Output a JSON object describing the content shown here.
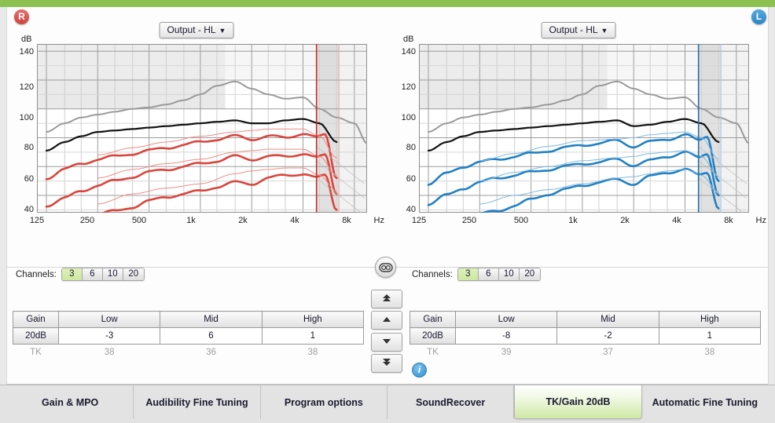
{
  "colors": {
    "accent_green": "#8cc152",
    "right_ear": "#d9534f",
    "left_ear": "#2f93d0",
    "right_curve": "#d9453c",
    "left_curve": "#2180c4",
    "mpo_curve": "#9a9a9a",
    "target_curve": "#111111",
    "selected_tab": "#cfe8a4"
  },
  "ear_badges": {
    "right": "R",
    "left": "L"
  },
  "panels": [
    {
      "side": "right",
      "dropdown_label": "Output - HL",
      "dropdown_caret": "▼",
      "channels_label": "Channels:",
      "channel_options": [
        "3",
        "6",
        "10",
        "20"
      ],
      "channel_selected": "3"
    },
    {
      "side": "left",
      "dropdown_label": "Output - HL",
      "dropdown_caret": "▼",
      "channels_label": "Channels:",
      "channel_options": [
        "3",
        "6",
        "10",
        "20"
      ],
      "channel_selected": "3"
    }
  ],
  "chart_data": [
    {
      "type": "line",
      "title": "Output - HL (Right ear)",
      "xlabel": "Hz",
      "ylabel": "dB",
      "x_tick_labels": [
        "125",
        "250",
        "500",
        "1k",
        "2k",
        "4k",
        "8k"
      ],
      "x_tick_hz": [
        125,
        250,
        500,
        1000,
        2000,
        4000,
        8000
      ],
      "y_tick_labels": [
        "140",
        "120",
        "100",
        "80",
        "60",
        "40"
      ],
      "ylim": [
        28,
        145
      ],
      "xlim_hz": [
        110,
        9500
      ],
      "grid": true,
      "legend": "none",
      "soundrecover_cutoff_hz": 4800,
      "series": [
        {
          "name": "MPO",
          "color": "#9a9a9a",
          "width": 2,
          "x": [
            125,
            160,
            200,
            250,
            315,
            400,
            500,
            630,
            800,
            1000,
            1250,
            1600,
            2000,
            2500,
            3150,
            4000,
            5000,
            6300,
            8000,
            9500
          ],
          "values": [
            84,
            90,
            94,
            96,
            98,
            100,
            101,
            103,
            106,
            110,
            116,
            119,
            114,
            110,
            107,
            108,
            100,
            94,
            90,
            76
          ]
        },
        {
          "name": "Target / 80 dB input",
          "color": "#111111",
          "width": 2.2,
          "x": [
            125,
            160,
            200,
            250,
            315,
            400,
            500,
            630,
            800,
            1000,
            1250,
            1600,
            2000,
            2500,
            3150,
            4000,
            5000,
            6300
          ],
          "values": [
            71,
            77,
            81,
            84,
            85,
            86,
            87,
            88,
            89,
            90,
            91,
            92,
            90,
            90,
            92,
            93,
            90,
            77
          ]
        },
        {
          "name": "Output 75 dB input",
          "color": "#d9453c",
          "width": 2.6,
          "x": [
            125,
            160,
            200,
            250,
            315,
            400,
            500,
            630,
            800,
            1000,
            1250,
            1600,
            2000,
            2500,
            3150,
            4000,
            4800,
            5400,
            6300
          ],
          "values": [
            52,
            58,
            62,
            65,
            67,
            69,
            71,
            73,
            75,
            77,
            79,
            81,
            79,
            81,
            80,
            83,
            80,
            82,
            52
          ]
        },
        {
          "name": "Output 55 dB input",
          "color": "#d9453c",
          "width": 2.6,
          "x": [
            125,
            160,
            200,
            250,
            315,
            400,
            500,
            630,
            800,
            1000,
            1250,
            1600,
            2000,
            2500,
            3150,
            4000,
            4800,
            5400,
            6300
          ],
          "values": [
            33,
            38,
            43,
            47,
            50,
            53,
            56,
            58,
            60,
            62,
            64,
            67,
            65,
            67,
            67,
            69,
            66,
            68,
            41
          ]
        },
        {
          "name": "Output 40 dB input",
          "color": "#d9453c",
          "width": 2.6,
          "x": [
            250,
            315,
            400,
            500,
            630,
            800,
            1000,
            1250,
            1600,
            2000,
            2500,
            3150,
            4000,
            4800,
            5400,
            6300
          ],
          "values": [
            27,
            29,
            32,
            36,
            39,
            41,
            43,
            46,
            49,
            48,
            52,
            54,
            55,
            52,
            54,
            30
          ]
        },
        {
          "name": "Unaided 75 dB reference",
          "color": "#ef8c86",
          "width": 1,
          "x": [
            250,
            400,
            630,
            1000,
            1600,
            2000,
            2500,
            3150,
            4000,
            5000,
            6300
          ],
          "values": [
            68,
            73,
            77,
            81,
            84,
            85,
            86,
            86,
            86,
            81,
            66
          ]
        },
        {
          "name": "Unaided 55 dB reference",
          "color": "#ef8c86",
          "width": 1,
          "x": [
            250,
            400,
            630,
            1000,
            1600,
            2000,
            2500,
            3150,
            4000,
            5000,
            6300
          ],
          "values": [
            52,
            58,
            62,
            65,
            70,
            71,
            72,
            72,
            72,
            67,
            54
          ]
        },
        {
          "name": "Unaided 40 dB reference",
          "color": "#ef8c86",
          "width": 1,
          "x": [
            250,
            400,
            630,
            1000,
            1600,
            2000,
            2500,
            3150,
            4000,
            5000,
            6300
          ],
          "values": [
            34,
            41,
            45,
            48,
            55,
            57,
            58,
            59,
            59,
            54,
            43
          ]
        }
      ]
    },
    {
      "type": "line",
      "title": "Output - HL (Left ear)",
      "xlabel": "Hz",
      "ylabel": "dB",
      "x_tick_labels": [
        "125",
        "250",
        "500",
        "1k",
        "2k",
        "4k",
        "8k"
      ],
      "x_tick_hz": [
        125,
        250,
        500,
        1000,
        2000,
        4000,
        8000
      ],
      "y_tick_labels": [
        "140",
        "120",
        "100",
        "80",
        "60",
        "40"
      ],
      "ylim": [
        28,
        145
      ],
      "xlim_hz": [
        110,
        9500
      ],
      "grid": true,
      "legend": "none",
      "soundrecover_cutoff_hz": 4800,
      "series": [
        {
          "name": "MPO",
          "color": "#9a9a9a",
          "width": 2,
          "x": [
            125,
            160,
            200,
            250,
            315,
            400,
            500,
            630,
            800,
            1000,
            1250,
            1600,
            2000,
            2500,
            3150,
            4000,
            5000,
            6300,
            8000,
            9500
          ],
          "values": [
            84,
            90,
            94,
            96,
            98,
            100,
            101,
            103,
            106,
            110,
            116,
            119,
            114,
            110,
            107,
            108,
            100,
            94,
            90,
            76
          ]
        },
        {
          "name": "Target / 80 dB input",
          "color": "#111111",
          "width": 2.2,
          "x": [
            125,
            160,
            200,
            250,
            315,
            400,
            500,
            630,
            800,
            1000,
            1250,
            1600,
            2000,
            2500,
            3150,
            4000,
            5000,
            6300
          ],
          "values": [
            71,
            77,
            81,
            84,
            85,
            86,
            87,
            88,
            89,
            90,
            91,
            92,
            88,
            89,
            91,
            93,
            90,
            77
          ]
        },
        {
          "name": "Output 75 dB input",
          "color": "#2180c4",
          "width": 2.6,
          "x": [
            125,
            160,
            200,
            250,
            315,
            400,
            500,
            630,
            800,
            1000,
            1250,
            1600,
            2000,
            2500,
            3150,
            4000,
            4800,
            5400,
            6300
          ],
          "values": [
            48,
            55,
            60,
            63,
            65,
            67,
            69,
            71,
            73,
            75,
            76,
            78,
            74,
            77,
            79,
            82,
            78,
            81,
            50
          ]
        },
        {
          "name": "Output 55 dB input",
          "color": "#2180c4",
          "width": 2.6,
          "x": [
            125,
            160,
            200,
            250,
            315,
            400,
            500,
            630,
            800,
            1000,
            1250,
            1600,
            2000,
            2500,
            3150,
            4000,
            4800,
            5400,
            6300
          ],
          "values": [
            34,
            40,
            45,
            49,
            52,
            54,
            56,
            58,
            60,
            62,
            63,
            65,
            61,
            64,
            67,
            70,
            66,
            69,
            40
          ]
        },
        {
          "name": "Output 40 dB input",
          "color": "#2180c4",
          "width": 2.6,
          "x": [
            250,
            315,
            400,
            500,
            630,
            800,
            1000,
            1250,
            1600,
            2000,
            2500,
            3150,
            4000,
            4800,
            5400,
            6300
          ],
          "values": [
            27,
            29,
            33,
            37,
            41,
            44,
            47,
            49,
            51,
            48,
            53,
            56,
            58,
            54,
            56,
            31
          ]
        },
        {
          "name": "Unaided 75 dB reference",
          "color": "#7db9e2",
          "width": 1,
          "x": [
            250,
            400,
            630,
            1000,
            1600,
            2000,
            2500,
            3150,
            4000,
            5000,
            6300
          ],
          "values": [
            64,
            69,
            74,
            78,
            79,
            80,
            82,
            83,
            84,
            80,
            65
          ]
        },
        {
          "name": "Unaided 55 dB reference",
          "color": "#7db9e2",
          "width": 1,
          "x": [
            250,
            400,
            630,
            1000,
            1600,
            2000,
            2500,
            3150,
            4000,
            5000,
            6300
          ],
          "values": [
            50,
            56,
            60,
            64,
            66,
            67,
            69,
            70,
            71,
            67,
            53
          ]
        },
        {
          "name": "Unaided 40 dB reference",
          "color": "#7db9e2",
          "width": 1,
          "x": [
            250,
            400,
            630,
            1000,
            1600,
            2000,
            2500,
            3150,
            4000,
            5000,
            6300
          ],
          "values": [
            34,
            40,
            44,
            48,
            52,
            53,
            55,
            57,
            58,
            54,
            42
          ]
        }
      ]
    }
  ],
  "tables": [
    {
      "side": "right",
      "headers": [
        "Gain",
        "Low",
        "Mid",
        "High"
      ],
      "gain_row": {
        "label": "20dB",
        "values": [
          "-3",
          "6",
          "1"
        ]
      },
      "tk_row": {
        "label": "TK",
        "values": [
          "38",
          "36",
          "38"
        ]
      }
    },
    {
      "side": "left",
      "headers": [
        "Gain",
        "Low",
        "Mid",
        "High"
      ],
      "gain_row": {
        "label": "20dB",
        "values": [
          "-8",
          "-2",
          "1"
        ]
      },
      "tk_row": {
        "label": "TK",
        "values": [
          "39",
          "37",
          "38"
        ]
      }
    }
  ],
  "steppers": [
    {
      "name": "increase-large",
      "glyph": "⤒"
    },
    {
      "name": "increase-small",
      "glyph": "▲"
    },
    {
      "name": "decrease-small",
      "glyph": "▼"
    },
    {
      "name": "decrease-large",
      "glyph": "⤓"
    }
  ],
  "info_button": {
    "glyph": "i"
  },
  "link_button": {
    "name": "link-ears-toggle"
  },
  "tabs": [
    {
      "label": "Gain & MPO",
      "active": false
    },
    {
      "label": "Audibility Fine Tuning",
      "active": false
    },
    {
      "label": "Program options",
      "active": false
    },
    {
      "label": "SoundRecover",
      "active": false
    },
    {
      "label": "TK/Gain 20dB",
      "active": true
    },
    {
      "label": "Automatic Fine Tuning",
      "active": false
    }
  ]
}
